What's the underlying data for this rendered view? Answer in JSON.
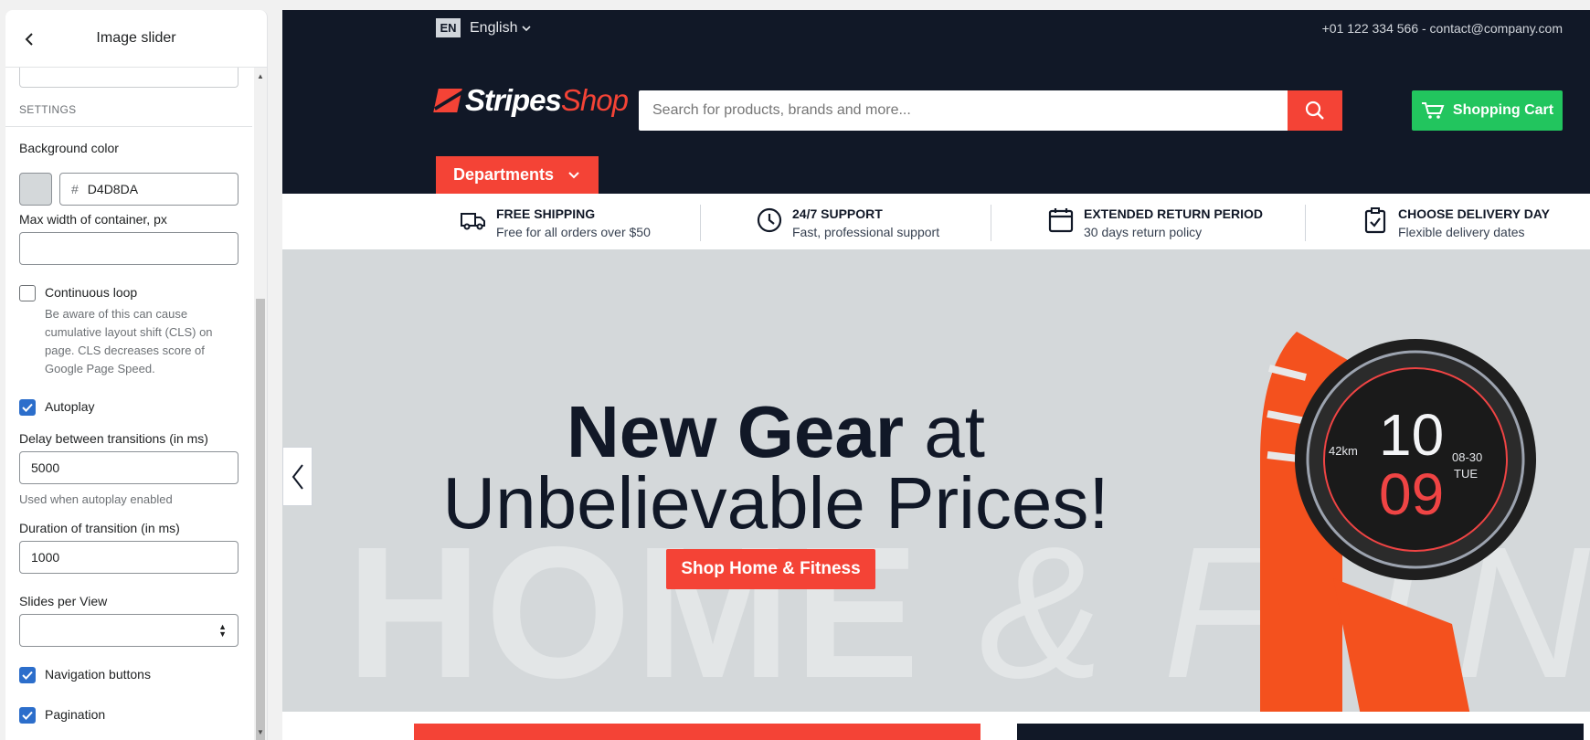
{
  "sidebar": {
    "title": "Image slider",
    "section": "SETTINGS",
    "background_color_label": "Background color",
    "background_color_swatch": "#D4D8DA",
    "background_color_value": "D4D8DA",
    "hex_prefix": "#",
    "max_width_label": "Max width of container, px",
    "max_width_value": "",
    "continuous_loop_label": "Continuous loop",
    "continuous_loop_checked": false,
    "continuous_loop_help": "Be aware of this can cause cumulative layout shift (CLS) on page. CLS decreases score of Google Page Speed.",
    "autoplay_label": "Autoplay",
    "autoplay_checked": true,
    "delay_label": "Delay between transitions (in ms)",
    "delay_value": "5000",
    "delay_help": "Used when autoplay enabled",
    "duration_label": "Duration of transition (in ms)",
    "duration_value": "1000",
    "slides_label": "Slides per View",
    "slides_value": "",
    "nav_buttons_label": "Navigation buttons",
    "nav_buttons_checked": true,
    "pagination_label": "Pagination",
    "pagination_checked": true
  },
  "store": {
    "lang_code": "EN",
    "lang_name": "English",
    "contact": "+01 122 334 566 - contact@company.com",
    "logo_part1": "Stripes",
    "logo_part2": "Shop",
    "search_placeholder": "Search for products, brands and more...",
    "cart_label": "Shopping Cart",
    "departments_label": "Departments",
    "features": [
      {
        "title": "FREE SHIPPING",
        "sub": "Free for all orders over $50",
        "icon": "truck-icon"
      },
      {
        "title": "24/7 SUPPORT",
        "sub": "Fast, professional support",
        "icon": "clock-icon"
      },
      {
        "title": "EXTENDED RETURN PERIOD",
        "sub": "30 days return policy",
        "icon": "calendar-icon"
      },
      {
        "title": "CHOOSE DELIVERY DAY",
        "sub": "Flexible delivery dates",
        "icon": "clipboard-check-icon"
      }
    ],
    "hero": {
      "bold": "New Gear",
      "rest": "at",
      "line2": "Unbelievable Prices!",
      "cta": "Shop Home & Fitness",
      "bg_word1": "HOME",
      "bg_word2": "& FITNESS",
      "watch_hour": "10",
      "watch_min": "09",
      "watch_dist": "42km",
      "watch_date": "08-30",
      "watch_day": "TUE"
    }
  },
  "colors": {
    "accent_red": "#f44336",
    "dark_navy": "#111827",
    "cart_green": "#22c55e",
    "checkbox_blue": "#2c6ecb",
    "hero_bg": "#d4d8da"
  }
}
